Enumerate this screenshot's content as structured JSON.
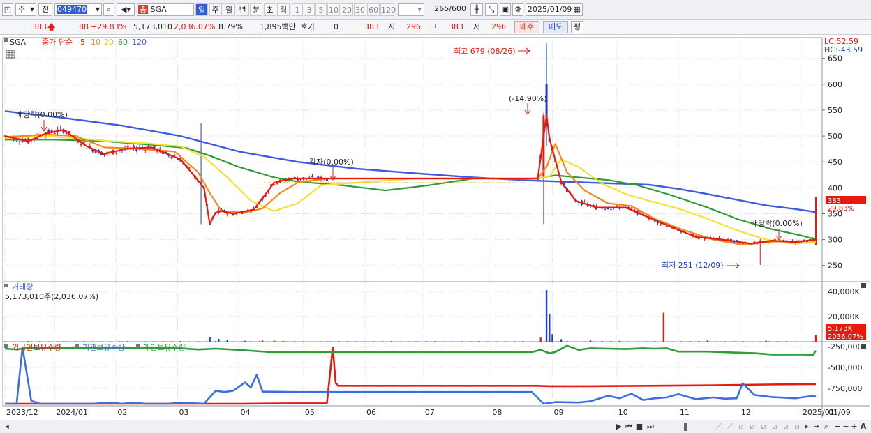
{
  "toolbar": {
    "market_select": "주",
    "prev_label": "전",
    "code": "049470",
    "market_badge": "종",
    "stock_name": "SGA",
    "periods": [
      "일",
      "주",
      "월",
      "년",
      "분",
      "초",
      "틱"
    ],
    "active_period": "일",
    "intervals": [
      "1",
      "3",
      "5",
      "10",
      "20",
      "30",
      "60",
      "120"
    ],
    "count": "265",
    "count_total": "/600",
    "date": "2025/01/09"
  },
  "quote": {
    "price": "383",
    "change": "88",
    "change_pct": "+29.83%",
    "volume": "5,173,010",
    "volume_pct": "2,036.07%",
    "turnover": "8.79%",
    "amount": "1,895백만",
    "hoga_label": "호가",
    "hoga_value": "0",
    "hoga_price": "383",
    "open_label": "시",
    "open": "296",
    "high_label": "고",
    "high": "383",
    "low_label": "저",
    "low": "296",
    "buy_label": "매수",
    "sell_label": "매도",
    "eval_label": "평"
  },
  "legend": {
    "name": "SGA",
    "ma_title": "종가 단순",
    "ma_periods": [
      "5",
      "10",
      "20",
      "60",
      "120"
    ],
    "volume_title": "거래량",
    "volume_info": "5,173,010주(2,036.07%)",
    "holding_series": [
      "외국인보유수량",
      "기관보유수량",
      "개인보유수량"
    ]
  },
  "annotations": {
    "high_label": "최고 679 (08/26)",
    "low_label": "최저 251 (12/09)",
    "pct_label": "(-14.90%)",
    "dividend_label_1": "배당락(0.00%)",
    "capital_label": "감자(0.00%)",
    "dividend_label_2": "배당락(0.00%)",
    "lc": "LC:52.59",
    "hc": "HC:-43.59",
    "last_price_tag": "383",
    "last_pct_tag": "29.83%",
    "vol_tag": "5,173K",
    "vol_pct_tag": "2036.07%",
    "next_month": "01/09"
  },
  "colors": {
    "up": "#e8190d",
    "down": "#1f3ec9",
    "ma5": "#e8190d",
    "ma10": "#f08a1e",
    "ma20": "#f5e132",
    "ma60": "#2f9b3a",
    "ma120": "#3c5be0",
    "foreign": "#e8190d",
    "institution": "#3c6ee0",
    "individual": "#2f9b3a"
  },
  "chart_data": [
    {
      "type": "candlestick",
      "title": "SGA",
      "ylim": [
        220,
        690
      ],
      "y_ticks": [
        250,
        300,
        350,
        400,
        450,
        500,
        550,
        600,
        650
      ],
      "x_ticks": [
        "2023/12",
        "2024/01",
        "02",
        "03",
        "04",
        "05",
        "06",
        "07",
        "08",
        "09",
        "10",
        "11",
        "12",
        "2025/01"
      ],
      "x_tick_at": [
        0,
        17,
        38,
        59,
        80,
        102,
        123,
        143,
        166,
        187,
        209,
        230,
        251,
        272
      ],
      "series": [
        {
          "name": "5",
          "x": [
            0,
            8,
            14,
            20,
            28,
            34,
            41,
            50,
            60,
            68,
            70,
            72,
            74,
            78,
            85,
            92,
            98,
            103,
            110,
            140,
            170,
            182,
            185,
            186,
            190,
            195,
            202,
            212,
            224,
            236,
            245,
            255,
            262,
            270,
            277
          ],
          "values": [
            500,
            490,
            505,
            512,
            480,
            465,
            475,
            478,
            455,
            400,
            330,
            352,
            355,
            350,
            358,
            410,
            418,
            418,
            418,
            418,
            418,
            418,
            540,
            495,
            412,
            375,
            362,
            362,
            333,
            305,
            300,
            292,
            298,
            295,
            300
          ]
        },
        {
          "name": "10",
          "x": [
            0,
            14,
            24,
            34,
            44,
            58,
            66,
            70,
            74,
            82,
            88,
            94,
            100,
            110,
            140,
            170,
            182,
            185,
            188,
            192,
            198,
            206,
            214,
            222,
            232,
            242,
            252,
            262,
            270,
            277
          ],
          "values": [
            498,
            503,
            500,
            478,
            476,
            470,
            430,
            390,
            355,
            352,
            360,
            390,
            410,
            418,
            418,
            418,
            418,
            440,
            485,
            430,
            395,
            370,
            365,
            340,
            318,
            300,
            290,
            296,
            297,
            298
          ]
        },
        {
          "name": "20",
          "x": [
            0,
            12,
            24,
            36,
            48,
            60,
            68,
            76,
            84,
            92,
            100,
            108,
            140,
            170,
            182,
            186,
            190,
            196,
            204,
            212,
            220,
            230,
            240,
            250,
            260,
            270,
            277
          ],
          "values": [
            496,
            500,
            496,
            490,
            486,
            480,
            460,
            420,
            375,
            355,
            370,
            405,
            418,
            418,
            418,
            422,
            455,
            440,
            408,
            388,
            375,
            360,
            340,
            318,
            300,
            292,
            295
          ]
        },
        {
          "name": "60",
          "x": [
            0,
            17,
            34,
            50,
            62,
            70,
            80,
            92,
            100,
            115,
            130,
            145,
            160,
            175,
            182,
            188,
            196,
            206,
            216,
            228,
            240,
            250,
            262,
            272,
            277
          ],
          "values": [
            493,
            493,
            490,
            483,
            477,
            462,
            440,
            420,
            412,
            405,
            395,
            405,
            418,
            418,
            418,
            424,
            420,
            415,
            405,
            385,
            362,
            340,
            320,
            308,
            300
          ]
        },
        {
          "name": "120",
          "x": [
            0,
            20,
            40,
            60,
            80,
            100,
            120,
            140,
            160,
            180,
            190,
            200,
            210,
            220,
            230,
            240,
            250,
            260,
            270,
            277
          ],
          "values": [
            548,
            535,
            520,
            500,
            470,
            450,
            437,
            428,
            420,
            414,
            412,
            410,
            408,
            406,
            398,
            388,
            377,
            366,
            359,
            353
          ]
        }
      ],
      "events": [
        {
          "label": "최고 679 (08/26)",
          "x": 185,
          "y": 679
        },
        {
          "label": "최저 251 (12/09)",
          "x": 258,
          "y": 251
        }
      ]
    },
    {
      "type": "bar",
      "title": "거래량",
      "ylim": [
        0,
        45000
      ],
      "y_ticks_labels": [
        "40,000K",
        "20,000K"
      ],
      "y_ticks": [
        40000,
        20000
      ],
      "x": [
        8,
        20,
        40,
        60,
        70,
        73,
        76,
        82,
        88,
        92,
        95,
        102,
        110,
        120,
        140,
        165,
        183,
        185,
        186,
        187,
        190,
        200,
        210,
        225,
        240,
        260,
        277
      ],
      "values": [
        400,
        300,
        200,
        500,
        3500,
        2200,
        1200,
        700,
        900,
        800,
        500,
        300,
        200,
        250,
        200,
        300,
        3200,
        41000,
        22000,
        6000,
        2000,
        900,
        700,
        23000,
        900,
        800,
        5173
      ],
      "series_dir": [
        "d",
        "u",
        "d",
        "d",
        "d",
        "d",
        "d",
        "d",
        "u",
        "u",
        "d",
        "d",
        "d",
        "d",
        "d",
        "d",
        "u",
        "d",
        "d",
        "d",
        "d",
        "d",
        "d",
        "u",
        "d",
        "d",
        "u"
      ]
    },
    {
      "type": "line",
      "title": "외국인보유수량 / 기관보유수량 / 개인보유수량",
      "ylim": [
        -960000,
        -200000
      ],
      "y_ticks": [
        -250000,
        -500000,
        -750000
      ],
      "y_tick_labels": [
        "-250,000",
        "-500,000",
        "-750,000"
      ],
      "series": [
        {
          "name": "외국인보유수량",
          "x": [
            0,
            5,
            10,
            60,
            68,
            80,
            100,
            110,
            112,
            113,
            114,
            120,
            150,
            182,
            186,
            200,
            220,
            240,
            260,
            277
          ],
          "values": [
            -935000,
            -935000,
            -935000,
            -935000,
            -935000,
            -935000,
            -930000,
            -930000,
            -260000,
            -690000,
            -720000,
            -720000,
            -720000,
            -720000,
            -725000,
            -725000,
            -720000,
            -715000,
            -705000,
            -700000
          ]
        },
        {
          "name": "기관보유수량",
          "x": [
            0,
            4,
            6,
            9,
            12,
            30,
            36,
            40,
            44,
            48,
            56,
            60,
            68,
            72,
            75,
            78,
            82,
            84,
            86,
            88,
            100,
            180,
            184,
            188,
            196,
            200,
            206,
            210,
            214,
            218,
            222,
            226,
            230,
            236,
            242,
            246,
            250,
            252,
            256,
            262,
            270,
            276,
            277
          ],
          "values": [
            -935000,
            -935000,
            -260000,
            -900000,
            -935000,
            -935000,
            -920000,
            -935000,
            -920000,
            -935000,
            -935000,
            -920000,
            -935000,
            -780000,
            -795000,
            -780000,
            -680000,
            -740000,
            -590000,
            -790000,
            -795000,
            -795000,
            -935000,
            -915000,
            -920000,
            -905000,
            -840000,
            -870000,
            -815000,
            -890000,
            -870000,
            -860000,
            -820000,
            -880000,
            -860000,
            -875000,
            -870000,
            -690000,
            -830000,
            -855000,
            -870000,
            -840000,
            -850000
          ]
        },
        {
          "name": "개인보유수량",
          "x": [
            0,
            4,
            8,
            40,
            60,
            66,
            72,
            80,
            90,
            100,
            120,
            150,
            180,
            183,
            186,
            188,
            192,
            196,
            200,
            206,
            212,
            218,
            222,
            226,
            230,
            240,
            248,
            256,
            262,
            268,
            272,
            276,
            277
          ],
          "values": [
            -275000,
            -285000,
            -265000,
            -265000,
            -270000,
            -285000,
            -275000,
            -290000,
            -315000,
            -315000,
            -315000,
            -315000,
            -315000,
            -290000,
            -330000,
            -315000,
            -240000,
            -290000,
            -270000,
            -275000,
            -280000,
            -270000,
            -275000,
            -270000,
            -310000,
            -310000,
            -320000,
            -330000,
            -345000,
            -345000,
            -345000,
            -350000,
            -300000
          ]
        }
      ]
    }
  ]
}
